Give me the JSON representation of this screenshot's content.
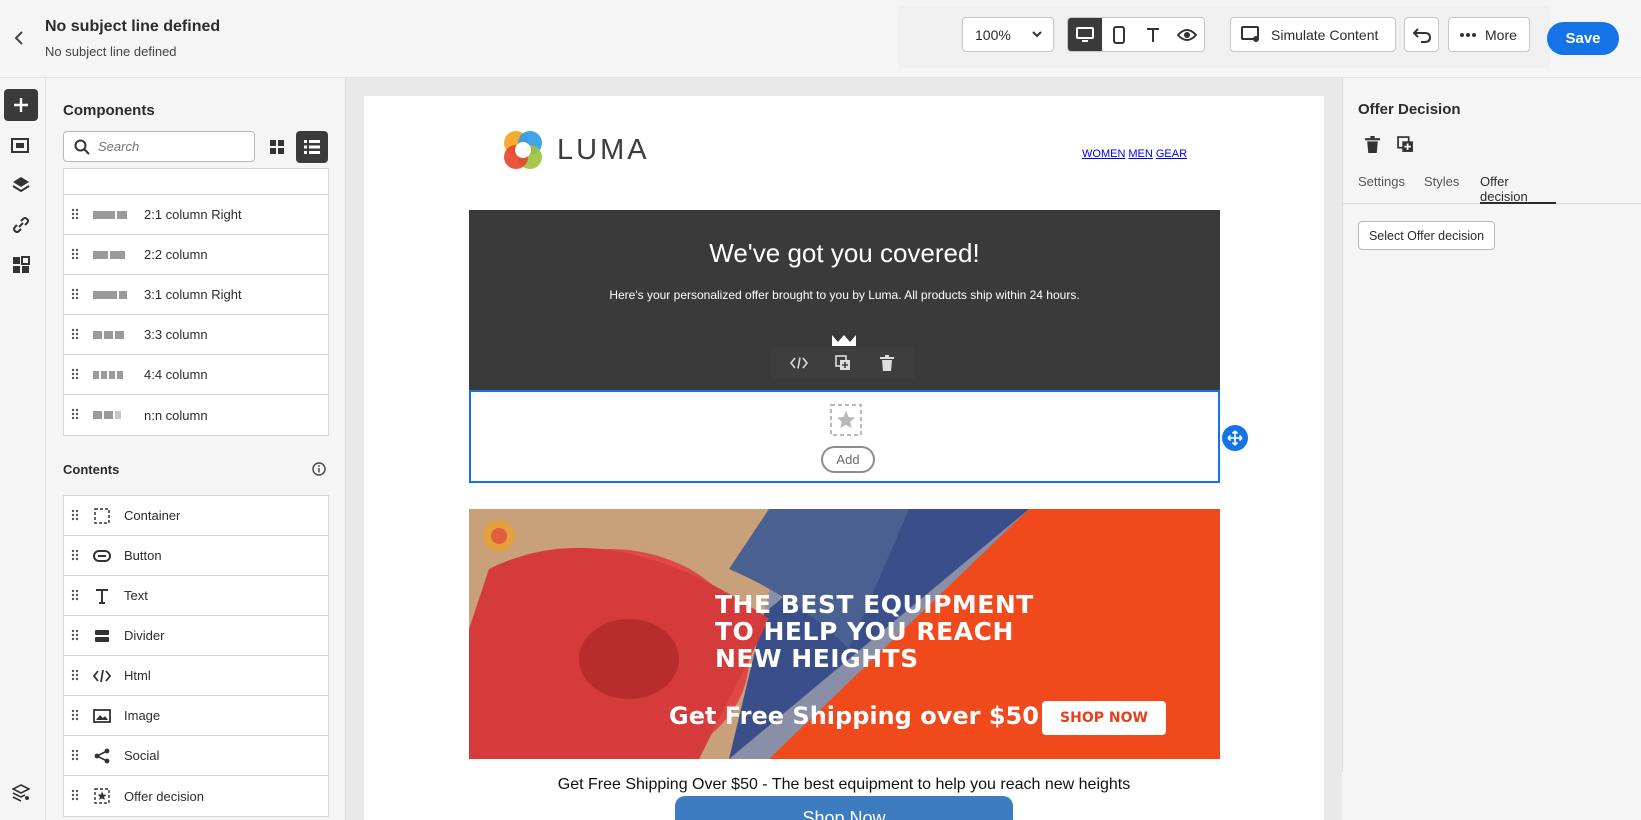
{
  "header": {
    "title": "No subject line defined",
    "subtitle": "No subject line defined",
    "zoom": "100%",
    "simulate_label": "Simulate Content",
    "more_label": "More",
    "save_label": "Save"
  },
  "components": {
    "title": "Components",
    "search_placeholder": "Search",
    "structures": [
      {
        "label": "2:1 column Right",
        "icon": "layout-2-1-icon"
      },
      {
        "label": "2:2 column",
        "icon": "layout-2-2-icon"
      },
      {
        "label": "3:1 column Right",
        "icon": "layout-3-1-icon"
      },
      {
        "label": "3:3 column",
        "icon": "layout-3-3-icon"
      },
      {
        "label": "4:4 column",
        "icon": "layout-4-4-icon"
      },
      {
        "label": "n:n column",
        "icon": "layout-n-n-icon"
      }
    ],
    "contents_title": "Contents",
    "contents": [
      {
        "label": "Container",
        "icon": "container-icon"
      },
      {
        "label": "Button",
        "icon": "button-icon"
      },
      {
        "label": "Text",
        "icon": "text-icon"
      },
      {
        "label": "Divider",
        "icon": "divider-icon"
      },
      {
        "label": "Html",
        "icon": "html-icon"
      },
      {
        "label": "Image",
        "icon": "image-icon"
      },
      {
        "label": "Social",
        "icon": "social-icon"
      },
      {
        "label": "Offer decision",
        "icon": "offer-decision-icon"
      }
    ]
  },
  "email": {
    "brand": "LUMA",
    "nav": [
      "WOMEN",
      "MEN",
      "GEAR"
    ],
    "hero_title": "We've got you covered!",
    "hero_subtitle": "Here's your personalized offer brought to you by Luma. All products ship within 24 hours.",
    "add_label": "Add",
    "banner_line1": "THE BEST EQUIPMENT",
    "banner_line2": "TO HELP YOU REACH",
    "banner_line3": "NEW HEIGHTS",
    "banner_shipping": "Get Free Shipping over $50",
    "banner_shop": "SHOP NOW",
    "caption": "Get Free Shipping Over $50 - The best equipment to help you reach new heights",
    "shop_button": "Shop Now"
  },
  "properties": {
    "title": "Offer Decision",
    "tabs": [
      "Settings",
      "Styles",
      "Offer decision"
    ],
    "active_tab": "Offer decision",
    "select_label": "Select Offer decision"
  },
  "colors": {
    "accent": "#1473e6",
    "hero_bg": "#3a3a3a",
    "banner_orange": "#f14e1a",
    "shop_button": "#3e7cc1"
  }
}
